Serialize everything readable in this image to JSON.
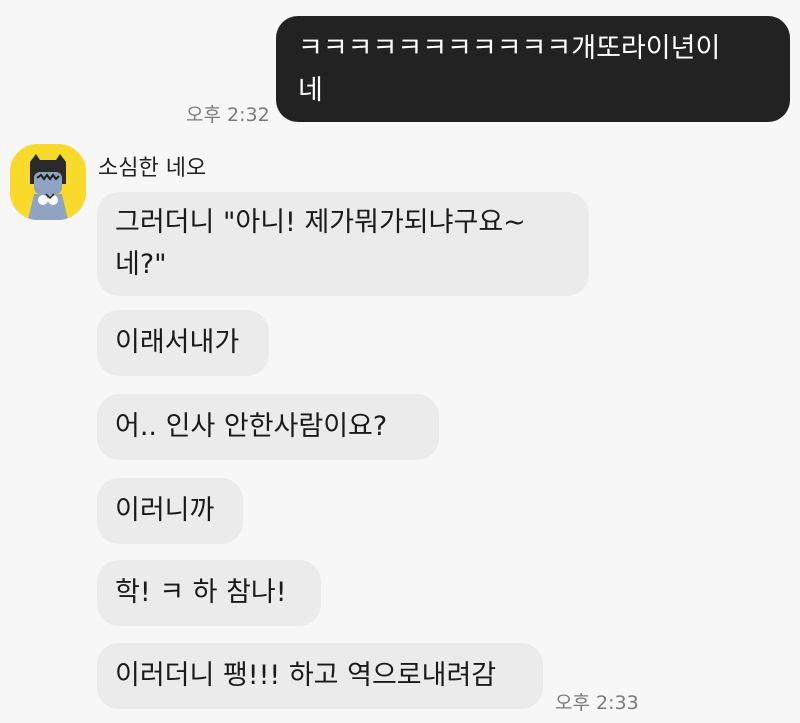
{
  "chat": {
    "outgoing": {
      "text": "ㅋㅋㅋㅋㅋㅋㅋㅋㅋㅋㅋ개또라이년이\n네",
      "time": "오후 2:32"
    },
    "contact": {
      "name": "소심한 네오",
      "avatar_icon": "neo-character-avatar-icon",
      "avatar_color": "#f9d92a"
    },
    "incoming": [
      "그러더니 \"아니! 제가뭐가되냐구요~\n네?\"",
      "이래서내가",
      "어.. 인사 안한사람이요?",
      "이러니까",
      "학! ㅋ 하 참나!",
      "이러더니 팽!!! 하고 역으로내려감"
    ],
    "incoming_time": "오후 2:33"
  }
}
